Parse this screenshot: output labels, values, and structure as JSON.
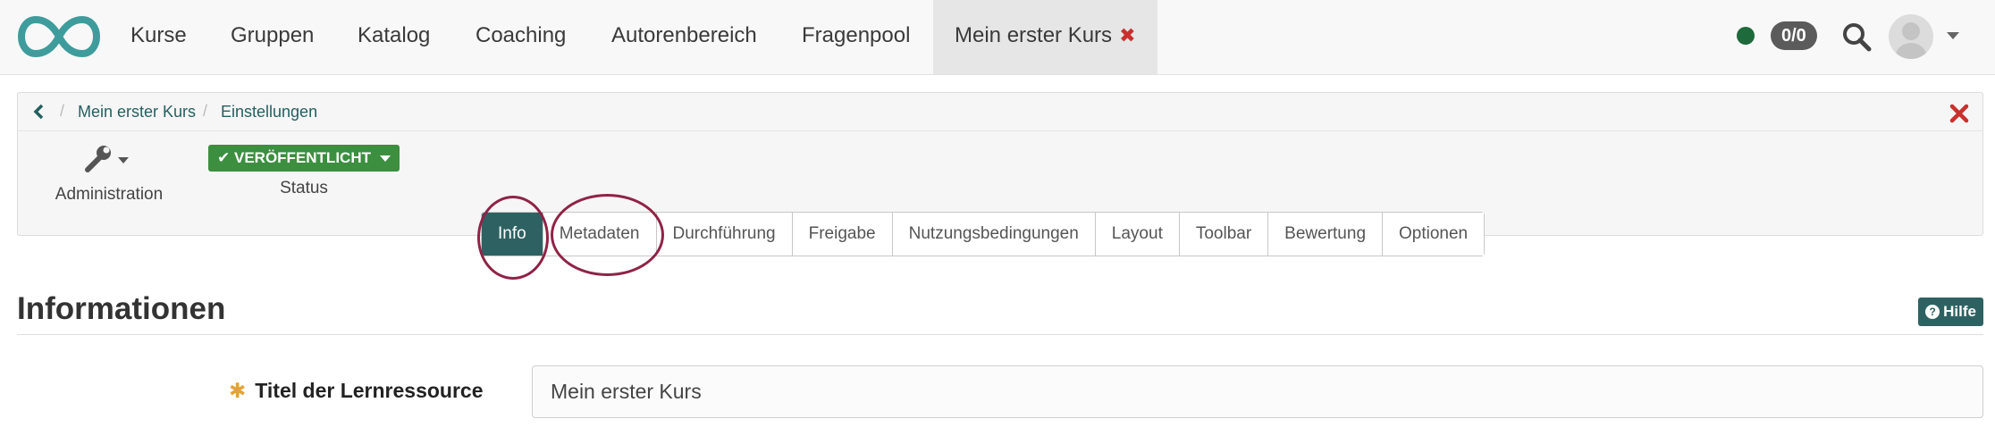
{
  "nav": {
    "items": [
      {
        "label": "Kurse"
      },
      {
        "label": "Gruppen"
      },
      {
        "label": "Katalog"
      },
      {
        "label": "Coaching"
      },
      {
        "label": "Autorenbereich"
      },
      {
        "label": "Fragenpool"
      }
    ],
    "active_course_tab": "Mein erster Kurs",
    "close_icon_glyph": "✖",
    "counter": "0/0",
    "status_dot_color": "#1e6a3a"
  },
  "breadcrumb": {
    "items": [
      "Mein erster Kurs",
      "Einstellungen"
    ]
  },
  "toolbar": {
    "administration_label": "Administration",
    "status_button_label": "✔ VERÖFFENTLICHT",
    "status_label": "Status",
    "status_color": "#3c8f3f"
  },
  "tabs": [
    {
      "label": "Info"
    },
    {
      "label": "Metadaten"
    },
    {
      "label": "Durchführung"
    },
    {
      "label": "Freigabe"
    },
    {
      "label": "Nutzungsbedingungen"
    },
    {
      "label": "Layout"
    },
    {
      "label": "Toolbar"
    },
    {
      "label": "Bewertung"
    },
    {
      "label": "Optionen"
    }
  ],
  "active_tab_index": 0,
  "content": {
    "title": "Informationen",
    "help_label": "Hilfe",
    "required_marker": "✱",
    "field_label": "Titel der Lernressource",
    "field_value": "Mein erster Kurs"
  },
  "colors": {
    "accent": "#2e6262",
    "annotation": "#8f2346",
    "close_red": "#c9302c"
  }
}
